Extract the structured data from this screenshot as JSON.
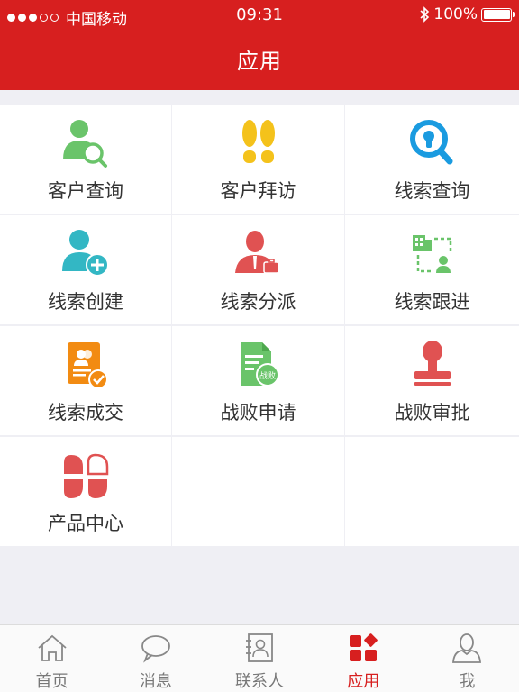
{
  "status_bar": {
    "carrier": "中国移动",
    "time": "09:31",
    "battery": "100%"
  },
  "header": {
    "title": "应用"
  },
  "apps": [
    {
      "label": "客户查询",
      "icon": "customer-search-icon"
    },
    {
      "label": "客户拜访",
      "icon": "footprints-icon"
    },
    {
      "label": "线索查询",
      "icon": "magnifier-icon"
    },
    {
      "label": "线索创建",
      "icon": "add-person-icon"
    },
    {
      "label": "线索分派",
      "icon": "business-person-icon"
    },
    {
      "label": "线索跟进",
      "icon": "building-person-icon"
    },
    {
      "label": "线索成交",
      "icon": "contract-check-icon"
    },
    {
      "label": "战败申请",
      "icon": "document-defeat-icon"
    },
    {
      "label": "战败审批",
      "icon": "stamp-icon"
    },
    {
      "label": "产品中心",
      "icon": "petals-icon"
    }
  ],
  "defeat_badge": "战败",
  "tabbar": [
    {
      "label": "首页",
      "icon": "home-icon"
    },
    {
      "label": "消息",
      "icon": "chat-bubble-icon"
    },
    {
      "label": "联系人",
      "icon": "contacts-book-icon"
    },
    {
      "label": "应用",
      "icon": "apps-icon",
      "active": true
    },
    {
      "label": "我",
      "icon": "person-icon"
    }
  ],
  "colors": {
    "brand": "#d71f1f",
    "green": "#6ac46a",
    "yellow": "#f4c21b",
    "blue": "#1a9be0",
    "teal": "#33b7c4",
    "orange": "#f28b12",
    "red": "#e05252"
  }
}
